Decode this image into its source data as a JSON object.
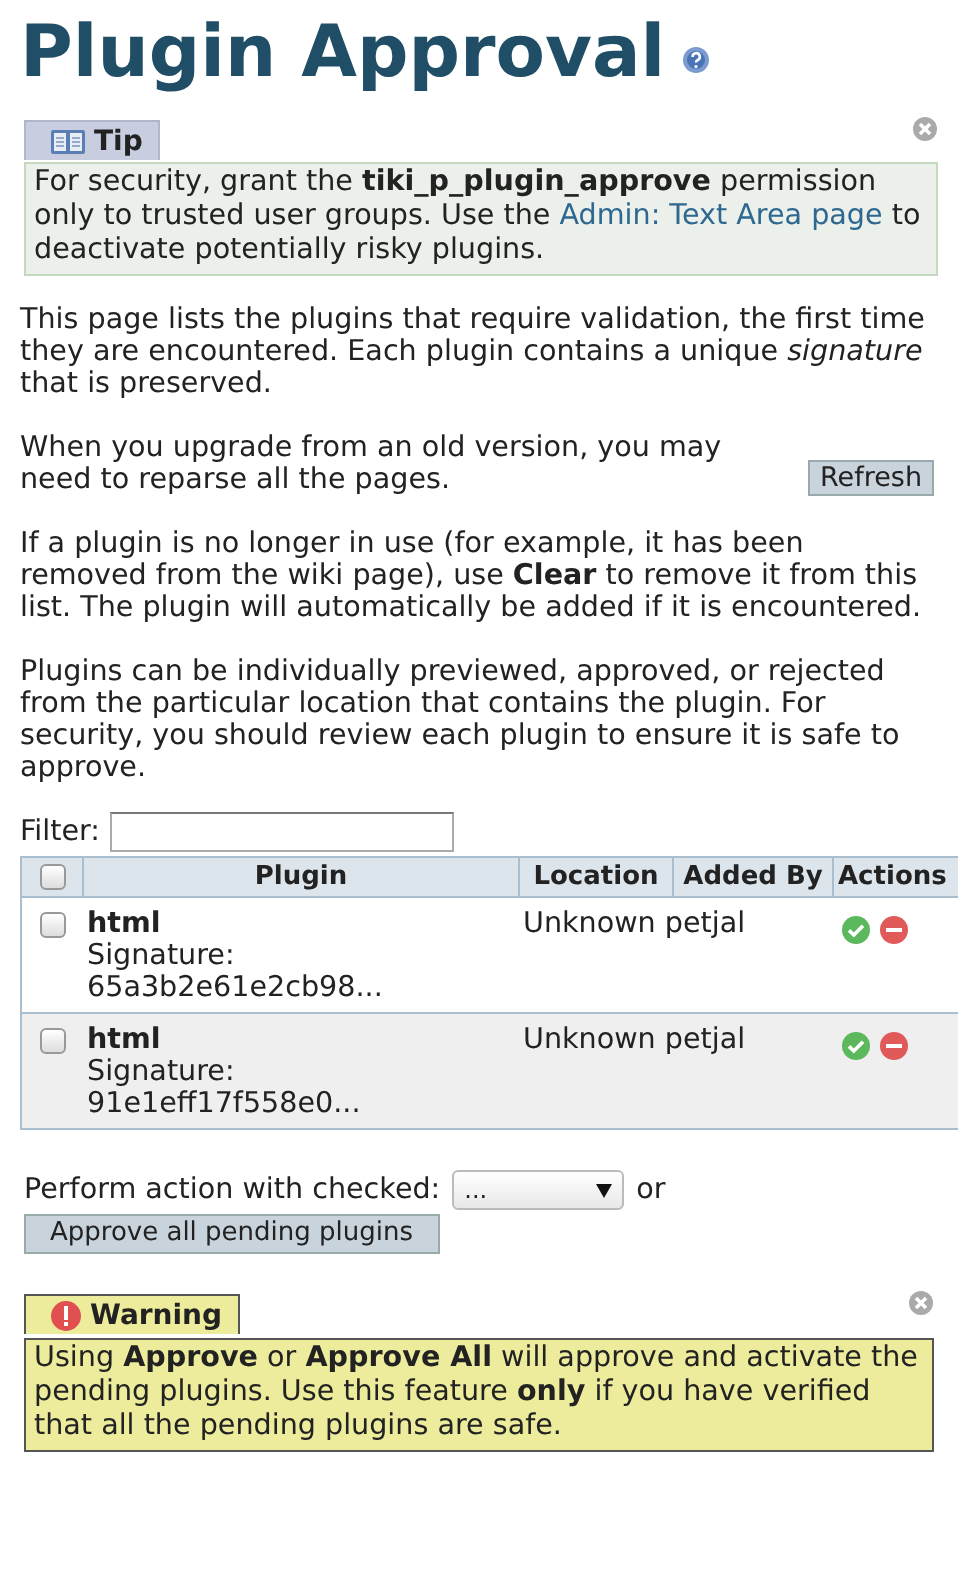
{
  "title": "Plugin Approval",
  "tip": {
    "kind": "tip",
    "heading": "Tip",
    "body": [
      {
        "kind": "text",
        "text": "For security, grant the **tiki_p_plugin_approve** permission only to trusted user groups. Use the "
      },
      {
        "kind": "link",
        "text": "Admin: Text Area page"
      },
      {
        "kind": "text",
        "text": " to deactivate potentially risky plugins."
      }
    ]
  },
  "paragraphs": [
    "This page lists the plugins that require validation, the first time they are encountered. Each plugin contains a unique *signature* that is preserved.",
    "When you upgrade from an old version, you may need to reparse all the pages.",
    "If a plugin is no longer in use (for example, it has been removed from the wiki page), use **Clear** to remove it from this list. The plugin will automatically be added if it is encountered.",
    "Plugins can be individually previewed, approved, or rejected from the particular location that contains the plugin. For security, you should review each plugin to ensure it is safe to approve."
  ],
  "refresh_button": "Refresh",
  "filter": {
    "label": "Filter:"
  },
  "table": {
    "select_all": {
      "checked": false
    },
    "columns": [
      "Plugin",
      "Location",
      "Added By",
      "Actions"
    ],
    "rows": [
      {
        "checked": false,
        "plugin": "html",
        "signature_label": "Signature:",
        "signature": "65a3b2e61e2cb98...",
        "location": "Unknown",
        "added_by": "petjal"
      },
      {
        "checked": false,
        "plugin": "html",
        "signature_label": "Signature:",
        "signature": "91e1eff17f558e0...",
        "location": "Unknown",
        "added_by": "petjal"
      }
    ]
  },
  "bulk": {
    "label": "Perform action with checked:",
    "select_value": "...",
    "or": "or",
    "approve_all_button": "Approve all pending plugins"
  },
  "warning": {
    "kind": "warning",
    "heading": "Warning",
    "body": [
      {
        "kind": "text",
        "text": "Using **Approve** or **Approve All** will approve and activate the pending plugins. Use this feature **only** if you have verified that all the pending plugins are safe."
      }
    ]
  }
}
